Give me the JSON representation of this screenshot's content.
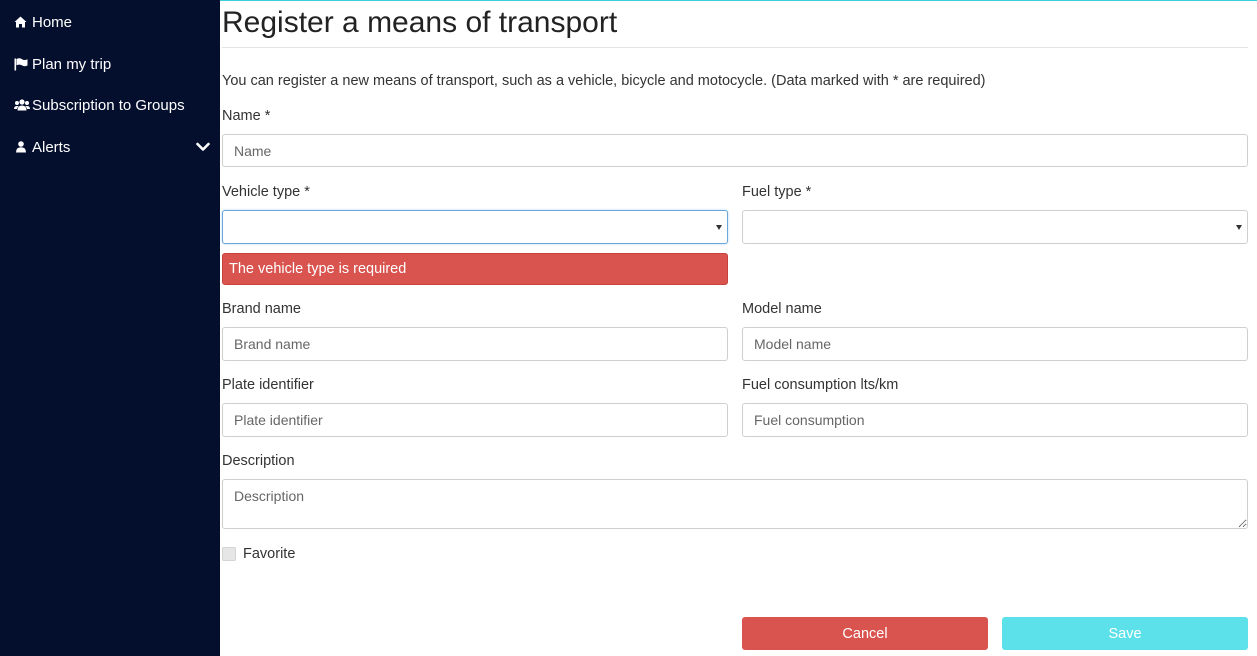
{
  "sidebar": {
    "items": [
      {
        "label": "Home",
        "icon": "home-icon"
      },
      {
        "label": "Plan my trip",
        "icon": "flag-icon"
      },
      {
        "label": "Subscription to Groups",
        "icon": "users-icon"
      },
      {
        "label": "Alerts",
        "icon": "user-icon",
        "expandable": true
      }
    ]
  },
  "page": {
    "title": "Register a means of transport",
    "intro": "You can register a new means of transport, such as a vehicle, bicycle and motocycle. (Data marked with * are required)"
  },
  "form": {
    "name": {
      "label": "Name *",
      "placeholder": "Name",
      "value": ""
    },
    "vehicle_type": {
      "label": "Vehicle type *",
      "value": "",
      "error": "The vehicle type is required"
    },
    "fuel_type": {
      "label": "Fuel type *",
      "value": ""
    },
    "brand_name": {
      "label": "Brand name",
      "placeholder": "Brand name",
      "value": ""
    },
    "model_name": {
      "label": "Model name",
      "placeholder": "Model name",
      "value": ""
    },
    "plate_identifier": {
      "label": "Plate identifier",
      "placeholder": "Plate identifier",
      "value": ""
    },
    "fuel_consumption": {
      "label": "Fuel consumption lts/km",
      "placeholder": "Fuel consumption",
      "value": ""
    },
    "description": {
      "label": "Description",
      "placeholder": "Description",
      "value": ""
    },
    "favorite": {
      "label": "Favorite",
      "checked": false
    }
  },
  "actions": {
    "cancel_label": "Cancel",
    "save_label": "Save"
  },
  "colors": {
    "sidebar_bg": "#040f2e",
    "error": "#d9534f",
    "save": "#5ce1ea",
    "accent": "#3ccfd6"
  }
}
